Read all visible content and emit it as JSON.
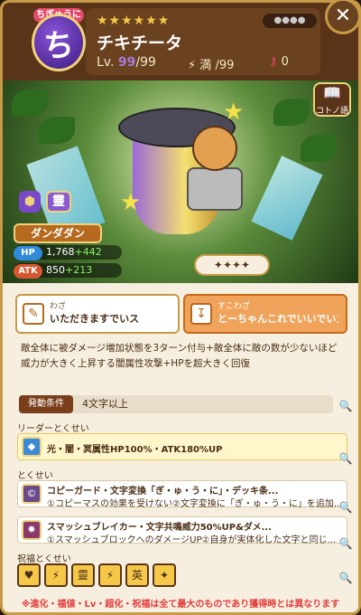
{
  "header": {
    "badge_label": "ちぎゅうに",
    "badge_symbol": "ち",
    "stars": "★★★★★★",
    "sockets": "●●●●",
    "name": "チキチータ",
    "lv_label": "Lv.",
    "lv_current": "99",
    "lv_max": "/99",
    "mana_label": "満",
    "mana_value": "/99",
    "key_count": "0",
    "close": "✕"
  },
  "art": {
    "book_button": "コトノ語"
  },
  "element": {
    "symbol": "靈"
  },
  "series_button": "ダンダダン",
  "stats": {
    "hp_label": "HP",
    "hp_base": "1,768",
    "hp_plus": "+442",
    "atk_label": "ATK",
    "atk_base": "850",
    "atk_plus": "+213"
  },
  "seals": "✦✦✦✦",
  "tabs": [
    {
      "kind": "わざ",
      "name": "いただきますでいス"
    },
    {
      "kind": "すこわざ",
      "name": "とーちゃんこれでいいでいスか!!"
    }
  ],
  "skill_description": "敵全体に被ダメージ増加状態を3ターン付与+敵全体に敵の数が少ないほど威力が大きく上昇する闇属性攻撃+HPを超大きく回復",
  "condition": {
    "label": "発動条件",
    "value": "4文字以上"
  },
  "leader": {
    "section": "リーダーとくせい",
    "text": "光・闇・冥属性HP100%・ATK180%UP"
  },
  "abilities_section": "とくせい",
  "abilities": [
    {
      "title": "コピーガード・文字変換「ぎ・ゅ・う・に」・デッキ条...",
      "sub": "①コピーマスの効果を受けない②文字変換に「ぎ・ゅ・う・に」を追加..."
    },
    {
      "title": "スマッシュブレイカー・文字共鳴威力50%UP&ダメ...",
      "sub": "①スマッシュブロックへのダメージUP②自身が実体化した文字と同じ..."
    }
  ],
  "blessing_section": "祝福とくせい",
  "blessings": [
    "♥",
    "⚡",
    "靈",
    "⚡",
    "英",
    "✦"
  ],
  "footer": "※進化・福値・Lv・超化・祝福は全て最大のものであり獲得時とは異なります"
}
